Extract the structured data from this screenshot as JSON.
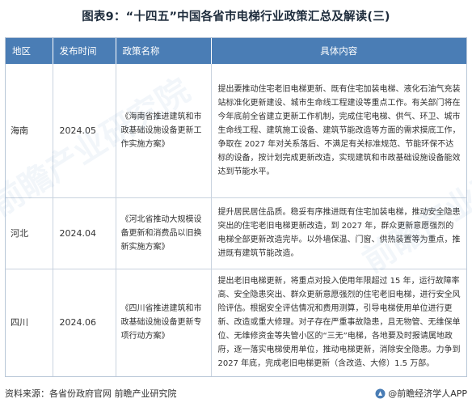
{
  "title": "图表9：“十四五”中国各省市电梯行业政策汇总及解读(三)",
  "table": {
    "headers": {
      "region": "地区",
      "date": "发布时间",
      "name": "政策名称",
      "content": "具体内容"
    },
    "rows": [
      {
        "region": "海南",
        "date": "2024.05",
        "name": "《海南省推进建筑和市政基础设施设备更新工作实施方案》",
        "content": "提出要推动住宅老旧电梯更新、既有住宅加装电梯、液化石油气充装站标准化更新建设、城市生命线工程建设等重点工作。有关部门将在今年底前全省建立更新工作机制，完成住宅电梯、供气、环卫、城市生命线工程、建筑施工设备、建筑节能改造等方面的需求摸底工作，争取在 2027 年对关系落后、不满足有关标准规范、节能环保不达标的设备，按计划完成更新改造，实现建筑和市政基础设施设备能效达到节能水平。"
      },
      {
        "region": "河北",
        "date": "2024.04",
        "name": "《河北省推动大规模设备更新和消费品以旧换新实施方案》",
        "content": "提升居民居住品质。稳妥有序推进既有住宅加装电梯，推动安全隐患突出的住宅老旧电梯更新改造，到 2027 年，群众更新意愿强烈的电梯全部更新改造完毕。以外墙保温、门窗、供热装置等为重点，推进既有建筑节能改造。"
      },
      {
        "region": "四川",
        "date": "2024.06",
        "name": "《四川省推进建筑和市政基础设施设备更新专项行动方案》",
        "content": "提出老旧电梯更新，将重点对投入使用年限超过 15 年，运行故障率高、安全隐患突出、群众更新意愿强烈的住宅老旧电梯，进行安全风险评估。根据安全评估情况和费用测算，引导电梯使用单位进行更新、改造或重大修理。对子存在严重事故隐患，且无物管、无维保单位、无维修资金等失管小区的“三无”电梯，各地要及时报请属地政府，逐一落实电梯使用单位，推动电梯更新，消除安全隐患。力争到 2027 年底，完成老旧电梯更新（含改造、大修）1.5 万部。"
      }
    ]
  },
  "footer": {
    "source": "资料来源：各省份政府官网 前瞻产业研究院",
    "brand": "@前瞻经济学人APP"
  },
  "watermark_text": "前瞻产业研究院",
  "colors": {
    "header_bg": "#4a7db5",
    "title": "#1f2d3d",
    "border": "#c9d3df"
  }
}
